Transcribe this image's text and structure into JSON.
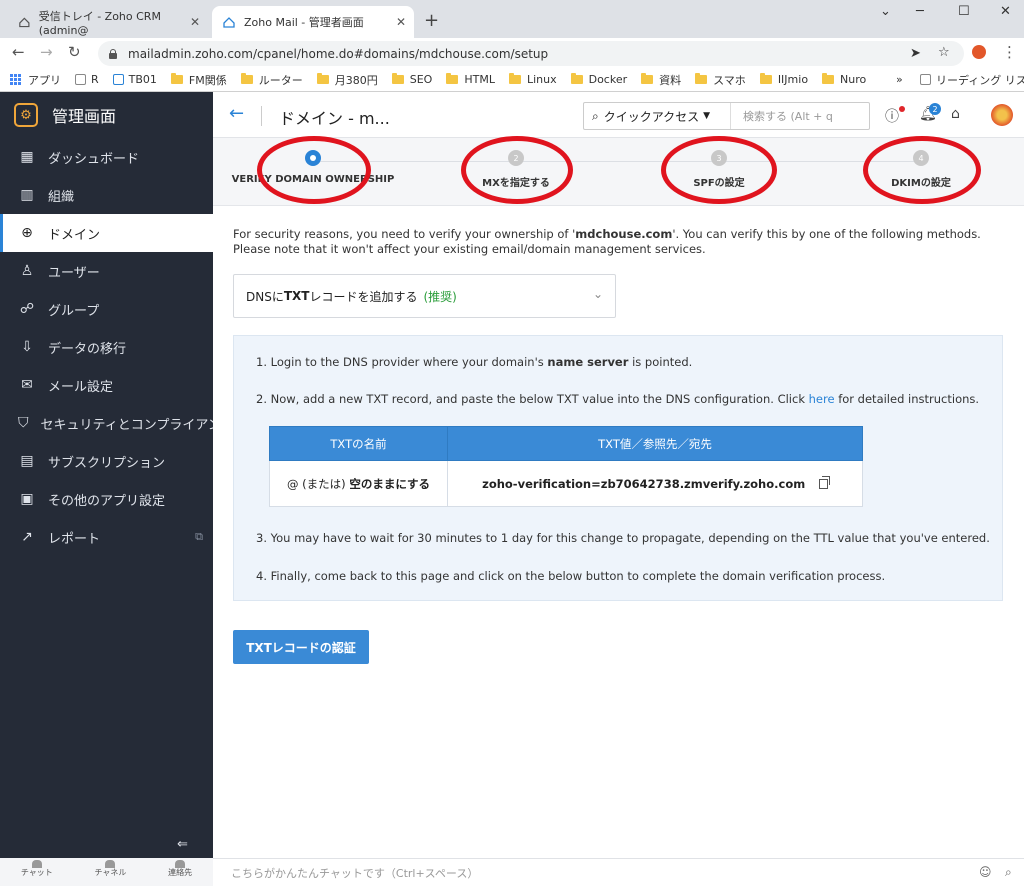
{
  "browser": {
    "tabs": [
      {
        "title": "受信トレイ - Zoho CRM (admin@"
      },
      {
        "title": "Zoho Mail - 管理者画面"
      }
    ],
    "url": "mailadmin.zoho.com/cpanel/home.do#domains/mdchouse.com/setup",
    "bookmarks": [
      "アプリ",
      "R",
      "TB01",
      "FM関係",
      "ルーター",
      "月380円",
      "SEO",
      "HTML",
      "Linux",
      "Docker",
      "資料",
      "スマホ",
      "IIJmio",
      "Nuro"
    ],
    "reading_list": "リーディング リスト",
    "more_bookmarks": "»"
  },
  "sidebar": {
    "title": "管理画面",
    "items": [
      {
        "label": "ダッシュボード",
        "icon": "dashboard-icon"
      },
      {
        "label": "組織",
        "icon": "building-icon"
      },
      {
        "label": "ドメイン",
        "icon": "globe-icon"
      },
      {
        "label": "ユーザー",
        "icon": "user-icon"
      },
      {
        "label": "グループ",
        "icon": "group-icon"
      },
      {
        "label": "データの移行",
        "icon": "migrate-icon"
      },
      {
        "label": "メール設定",
        "icon": "mail-settings-icon"
      },
      {
        "label": "セキュリティとコンプライアンス",
        "icon": "shield-icon"
      },
      {
        "label": "サブスクリプション",
        "icon": "subscription-icon"
      },
      {
        "label": "その他のアプリ設定",
        "icon": "apps-icon"
      },
      {
        "label": "レポート",
        "icon": "report-icon"
      }
    ],
    "footer": [
      "チャット",
      "チャネル",
      "連絡先"
    ]
  },
  "header": {
    "title": "ドメイン - m...",
    "quick_access": "クイックアクセス",
    "search_placeholder": "検索する (Alt + q",
    "notification_count": "2"
  },
  "stepper": {
    "steps": [
      {
        "num": "1",
        "label": "VERIFY DOMAIN OWNERSHIP"
      },
      {
        "num": "2",
        "label": "MXを指定する"
      },
      {
        "num": "3",
        "label": "SPFの設定"
      },
      {
        "num": "4",
        "label": "DKIMの設定"
      }
    ]
  },
  "content": {
    "intro_pre": "For security reasons, you need to verify your ownership of '",
    "intro_domain": "mdchouse.com",
    "intro_post": "'. You can verify this by one of the following methods. Please note that it won't affect your existing email/domain management services.",
    "method_prefix": "DNSに",
    "method_bold": "TXT",
    "method_suffix": "レコードを追加する",
    "method_recommended": "(推奨)",
    "step1_pre": "1. Login to the DNS provider where your domain's ",
    "step1_bold": "name server",
    "step1_post": " is pointed.",
    "step2_pre": "2. Now, add a new TXT record, and paste the below TXT value into the DNS configuration. Click ",
    "step2_link": "here",
    "step2_post": " for detailed instructions.",
    "table": {
      "col_name": "TXTの名前",
      "col_value": "TXT値／参照先／宛先",
      "row_name_prefix": "@ (または)",
      "row_name_bold": "空のままにする",
      "row_value": "zoho-verification=zb70642738.zmverify.zoho.com"
    },
    "step3": "3. You may have to wait for 30 minutes to 1 day for this change to propagate, depending on the TTL value that you've entered.",
    "step4": "4. Finally, come back to this page and click on the below button to complete the domain verification process.",
    "verify_button": "TXTレコードの認証"
  },
  "chat": {
    "placeholder": "こちらがかんたんチャットです（Ctrl+スペース）"
  },
  "colors": {
    "accent": "#2a83d6",
    "sidebar_bg": "#252b37",
    "annotation_red": "#e0141e"
  }
}
